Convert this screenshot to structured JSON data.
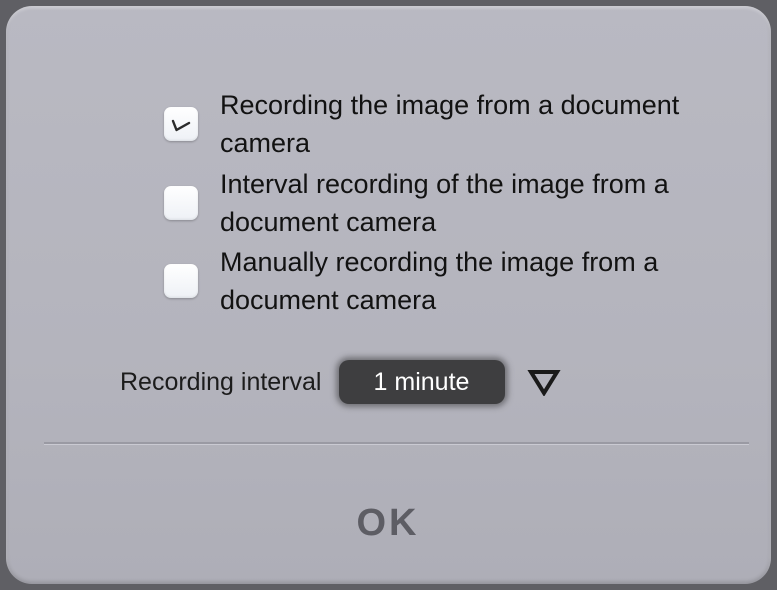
{
  "options": [
    {
      "label": "Recording the image from a document camera",
      "checked": true
    },
    {
      "label": "Interval recording of the image from a document camera",
      "checked": false
    },
    {
      "label": "Manually recording the image from a document camera",
      "checked": false
    }
  ],
  "interval": {
    "label": "Recording interval",
    "selected": "1 minute",
    "arrow_icon": "triangle-down-icon"
  },
  "ok_button": {
    "label": "OK"
  },
  "colors": {
    "dialog_bg": "#b6b6bf",
    "select_bg": "#3e3e40",
    "ok_text": "#5d5d64"
  }
}
